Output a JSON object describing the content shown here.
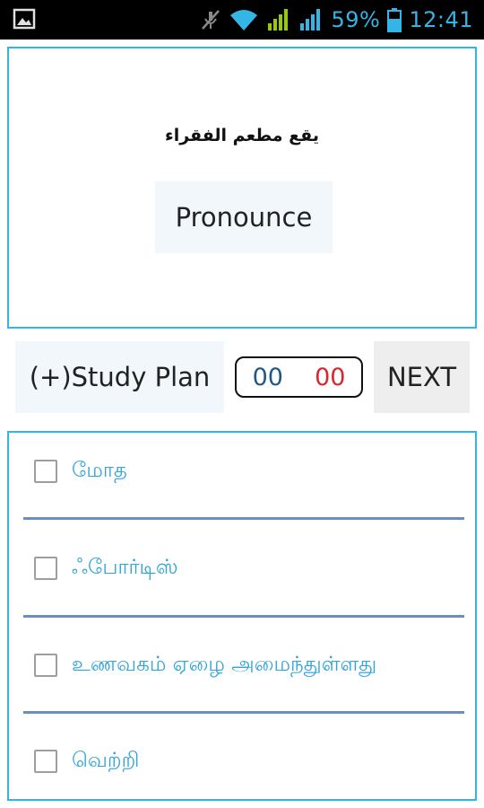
{
  "status_bar": {
    "battery": "59%",
    "time": "12:41",
    "icons": [
      "gallery-icon",
      "mute-icon",
      "wifi-icon",
      "signal-icon",
      "battery-icon"
    ],
    "accent_color": "#33b5e5"
  },
  "question": {
    "text": "يقع مطعم الفقراء",
    "pronounce_label": "Pronounce"
  },
  "controls": {
    "study_plan_label": "(+)Study Plan",
    "timer_minutes": "00",
    "timer_seconds": "00",
    "next_label": "NEXT"
  },
  "options": [
    {
      "label": "மோத",
      "checked": false
    },
    {
      "label": "ஃபோர்டிஸ்",
      "checked": false
    },
    {
      "label": "உணவகம் ஏழை அமைந்துள்ளது",
      "checked": false
    },
    {
      "label": "வெற்றி",
      "checked": false
    }
  ],
  "colors": {
    "border": "#33b5e5",
    "option_text": "#33a4d8",
    "divider": "#6a8ec0",
    "timer_seconds": "#d8272d",
    "timer_minutes": "#1c5a8a"
  }
}
